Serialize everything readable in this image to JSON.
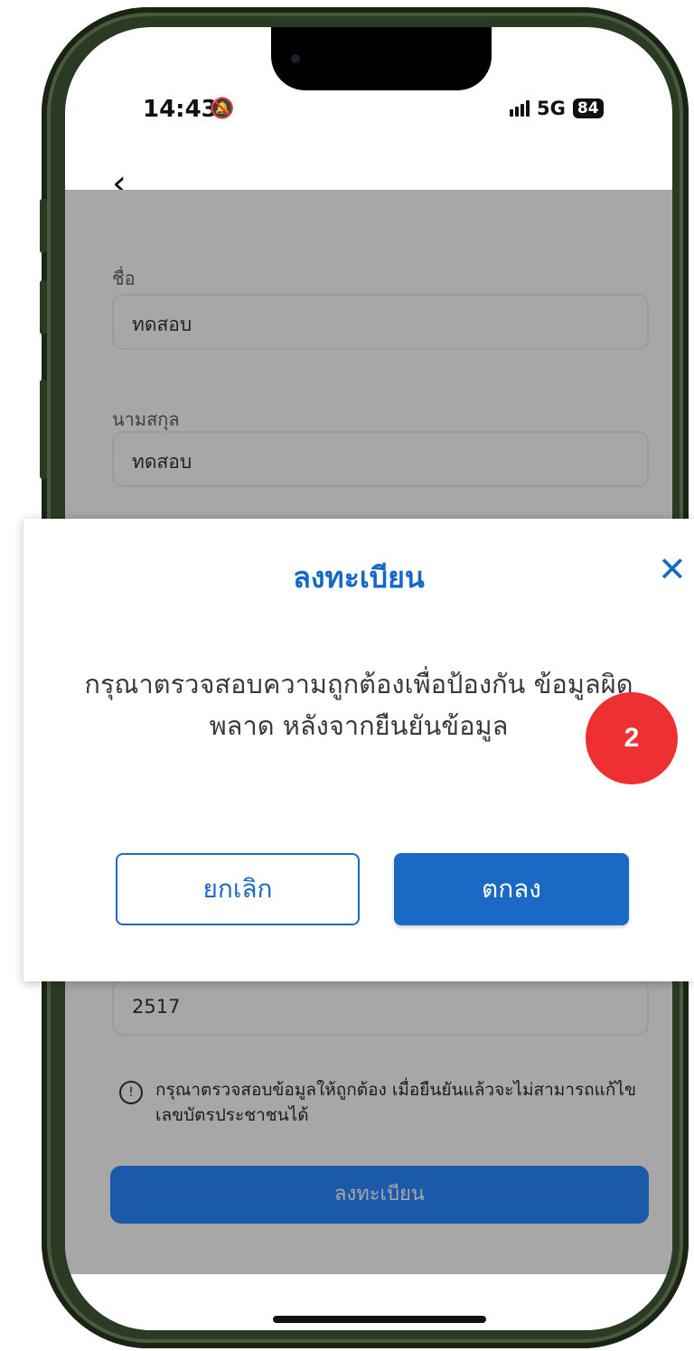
{
  "status_bar": {
    "time": "14:43",
    "network": "5G",
    "battery": "84"
  },
  "form": {
    "first_name_label": "ชื่อ",
    "first_name_value": "ทดสอบ",
    "last_name_label": "นามสกุล",
    "last_name_value": "ทดสอบ",
    "partial_field_value": "2517",
    "notice_text": "กรุณาตรวจสอบข้อมูลให้ถูกต้อง เมื่อยืนยันแล้วจะไม่สามารถแก้ไข เลขบัตรประชาชนได้",
    "register_button": "ลงทะเบียน"
  },
  "dialog": {
    "title": "ลงทะเบียน",
    "message": "กรุณาตรวจสอบความถูกต้องเพื่อป้องกัน ข้อมูลผิดพลาด หลังจากยืนยันข้อมูล",
    "cancel_label": "ยกเลิก",
    "ok_label": "ตกลง"
  },
  "step_badge": "2",
  "colors": {
    "accent": "#1a6ac5",
    "badge": "#ee3033",
    "overlay": "#a7a7a7"
  }
}
